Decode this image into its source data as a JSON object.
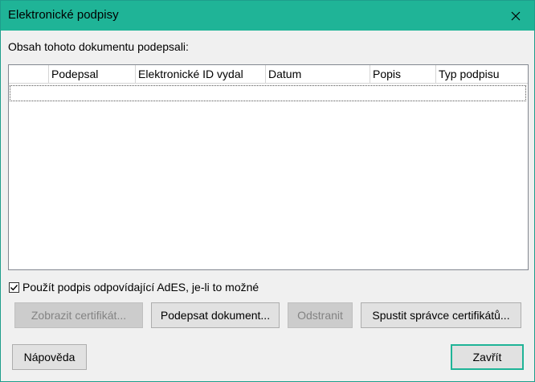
{
  "window": {
    "title": "Elektronické podpisy"
  },
  "caption": "Obsah tohoto dokumentu podepsali:",
  "table": {
    "columns": [
      "",
      "Podepsal",
      "Elektronické ID vydal",
      "Datum",
      "Popis",
      "Typ podpisu"
    ],
    "rows": []
  },
  "ades_option": {
    "checked": true,
    "label": "Použít podpis odpovídající AdES, je-li to možné"
  },
  "buttons": {
    "view_certificate": "Zobrazit certifikát...",
    "sign_document": "Podepsat dokument...",
    "remove": "Odstranit",
    "start_certificate_manager": "Spustit správce certifikátů...",
    "help": "Nápověda",
    "close": "Zavřít"
  },
  "colors": {
    "titlebar": "#1fb497",
    "window_background": "#f0f0f0",
    "disabled_text": "#838383"
  }
}
